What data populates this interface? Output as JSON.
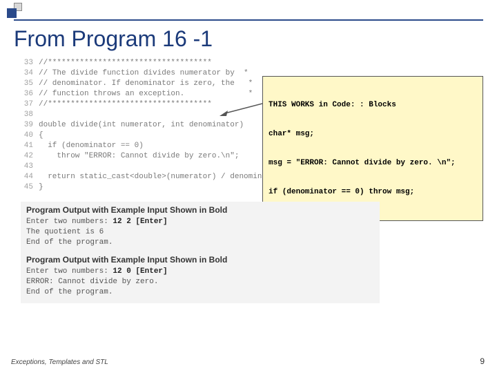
{
  "title": "From Program 16 -1",
  "code": {
    "lines": [
      {
        "n": "33",
        "t": "//************************************"
      },
      {
        "n": "34",
        "t": "// The divide function divides numerator by  *"
      },
      {
        "n": "35",
        "t": "// denominator. If denominator is zero, the   *"
      },
      {
        "n": "36",
        "t": "// function throws an exception.              *"
      },
      {
        "n": "37",
        "t": "//************************************"
      },
      {
        "n": "38",
        "t": ""
      },
      {
        "n": "39",
        "t": "double divide(int numerator, int denominator)"
      },
      {
        "n": "40",
        "t": "{"
      },
      {
        "n": "41",
        "t": "  if (denominator == 0)"
      },
      {
        "n": "42",
        "t": "    throw \"ERROR: Cannot divide by zero.\\n\";"
      },
      {
        "n": "43",
        "t": ""
      },
      {
        "n": "44",
        "t": "  return static_cast<double>(numerator) / denominator;"
      },
      {
        "n": "45",
        "t": "}"
      }
    ]
  },
  "callout": {
    "l1": "THIS WORKS in Code: : Blocks",
    "l2": "char* msg;",
    "l3": "msg = \"ERROR: Cannot divide by zero. \\n\";",
    "l4": "if (denominator == 0) throw msg;"
  },
  "output1": {
    "head": "Program Output with Example Input Shown in Bold",
    "prompt": "Enter two numbers: ",
    "input": "12 2 [Enter]",
    "r1": "The quotient is 6",
    "r2": "End of the program."
  },
  "output2": {
    "head": "Program Output with Example Input Shown in Bold",
    "prompt": "Enter two numbers: ",
    "input": "12 0 [Enter]",
    "r1": "ERROR: Cannot divide by zero.",
    "r2": "End of the program."
  },
  "footer": "Exceptions, Templates and STL",
  "pagenum": "9"
}
